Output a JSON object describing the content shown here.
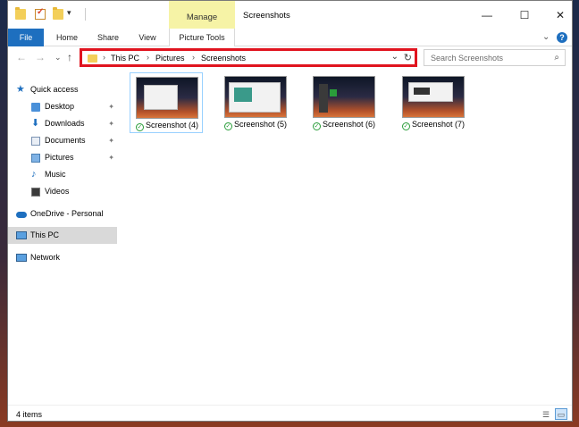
{
  "window": {
    "title": "Screenshots",
    "contextual_tab": "Manage",
    "controls": {
      "minimize": "—",
      "maximize": "☐",
      "close": "✕"
    }
  },
  "quick_access_toolbar": {
    "dropdown": "▾"
  },
  "ribbon": {
    "tabs": [
      "File",
      "Home",
      "Share",
      "View",
      "Picture Tools"
    ],
    "expand": "⌄",
    "help": "?"
  },
  "navigation": {
    "back": "←",
    "forward": "→",
    "recent": "⌄",
    "up": "↑"
  },
  "address": {
    "breadcrumbs": [
      "This PC",
      "Pictures",
      "Screenshots"
    ],
    "separator": "›",
    "dropdown": "⌄",
    "refresh": "↻"
  },
  "search": {
    "placeholder": "Search Screenshots",
    "icon": "⌕"
  },
  "sidebar": {
    "items": [
      {
        "label": "Quick access",
        "icon": "star-icon"
      },
      {
        "label": "Desktop",
        "icon": "desktop-folder-icon",
        "pinned": true
      },
      {
        "label": "Downloads",
        "icon": "downloads-folder-icon",
        "pinned": true
      },
      {
        "label": "Documents",
        "icon": "documents-folder-icon",
        "pinned": true
      },
      {
        "label": "Pictures",
        "icon": "pictures-folder-icon",
        "pinned": true
      },
      {
        "label": "Music",
        "icon": "music-folder-icon"
      },
      {
        "label": "Videos",
        "icon": "videos-folder-icon"
      },
      {
        "label": "OneDrive - Personal",
        "icon": "onedrive-cloud-icon"
      },
      {
        "label": "This PC",
        "icon": "this-pc-icon",
        "selected": true
      },
      {
        "label": "Network",
        "icon": "network-icon"
      }
    ],
    "pin_glyph": "📌"
  },
  "files": [
    {
      "name": "Screenshot (4)",
      "selected": true
    },
    {
      "name": "Screenshot (5)"
    },
    {
      "name": "Screenshot (6)"
    },
    {
      "name": "Screenshot (7)"
    }
  ],
  "status": {
    "count": "4 items"
  },
  "colors": {
    "file_tab": "#1e6fbf",
    "manage_tab": "#f6f3a6",
    "highlight_border": "#e0141f",
    "selection": "#cce8ff"
  }
}
